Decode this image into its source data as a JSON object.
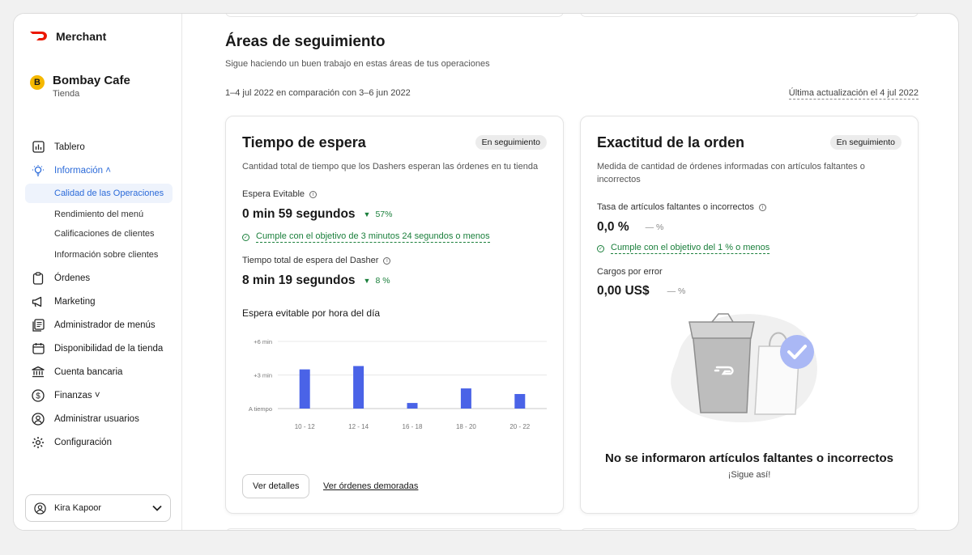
{
  "brand": {
    "name": "Merchant",
    "color": "#eb1700"
  },
  "store": {
    "initial": "B",
    "name": "Bombay Cafe",
    "type": "Tienda"
  },
  "nav": {
    "items": [
      {
        "label": "Tablero",
        "icon": "chart-icon"
      },
      {
        "label": "Información ˄",
        "icon": "lightbulb-icon",
        "active": true
      },
      {
        "label": "Órdenes",
        "icon": "clipboard-icon"
      },
      {
        "label": "Marketing",
        "icon": "megaphone-icon"
      },
      {
        "label": "Administrador de menús",
        "icon": "menu-book-icon"
      },
      {
        "label": "Disponibilidad de la tienda",
        "icon": "calendar-icon"
      },
      {
        "label": "Cuenta bancaria",
        "icon": "bank-icon"
      },
      {
        "label": "Finanzas ˅",
        "icon": "dollar-icon"
      },
      {
        "label": "Administrar usuarios",
        "icon": "user-icon"
      },
      {
        "label": "Configuración",
        "icon": "gear-icon"
      }
    ],
    "subitems": [
      "Calidad de las Operaciones",
      "Rendimiento del menú",
      "Calificaciones de clientes",
      "Información sobre clientes"
    ]
  },
  "user": {
    "name": "Kira Kapoor"
  },
  "section": {
    "title": "Áreas de seguimiento",
    "subtitle": "Sigue haciendo un buen trabajo en estas áreas de tus operaciones",
    "compare": "1–4 jul 2022 en comparación con 3–6 jun 2022",
    "updated": "Última actualización el 4 jul 2022"
  },
  "wait_card": {
    "title": "Tiempo de espera",
    "status": "En seguimiento",
    "desc": "Cantidad total de tiempo que los Dashers esperan las órdenes en tu tienda",
    "m1_label": "Espera Evitable",
    "m1_value": "0 min 59 segundos",
    "m1_delta": "57%",
    "goal": "Cumple con el objetivo de 3 minutos 24 segundos o menos",
    "m2_label": "Tiempo total de espera del Dasher",
    "m2_value": "8 min 19 segundos",
    "m2_delta": "8 %",
    "chart_title": "Espera evitable por hora del día",
    "details_btn": "Ver detalles",
    "delayed_link": "Ver órdenes demoradas"
  },
  "accuracy_card": {
    "title": "Exactitud de la orden",
    "status": "En seguimiento",
    "desc_line1": "Medida de cantidad de órdenes informadas con artículos faltantes o",
    "desc_line2": "incorrectos",
    "m1_label": "Tasa de artículos faltantes o incorrectos",
    "m1_value": "0,0 %",
    "m1_delta": "— %",
    "goal": "Cumple con el objetivo del 1 % o menos",
    "m2_label": "Cargos por error",
    "m2_value": "0,00 US$",
    "m2_delta": "— %",
    "empty_title": "No se informaron artículos faltantes o incorrectos",
    "empty_sub": "¡Sigue así!"
  },
  "chart_data": {
    "type": "bar",
    "title": "Espera evitable por hora del día",
    "categories": [
      "10 - 12",
      "12 - 14",
      "16 - 18",
      "18 - 20",
      "20 - 22"
    ],
    "values": [
      3.5,
      3.8,
      0.5,
      1.8,
      1.3
    ],
    "ytick_labels": [
      "A tiempo",
      "+3 min",
      "+6 min"
    ],
    "ylim": [
      0,
      6
    ],
    "bar_color": "#4a63e7",
    "grid": true
  },
  "colors": {
    "accent": "#2c6bd9",
    "positive": "#1a7f3b"
  }
}
